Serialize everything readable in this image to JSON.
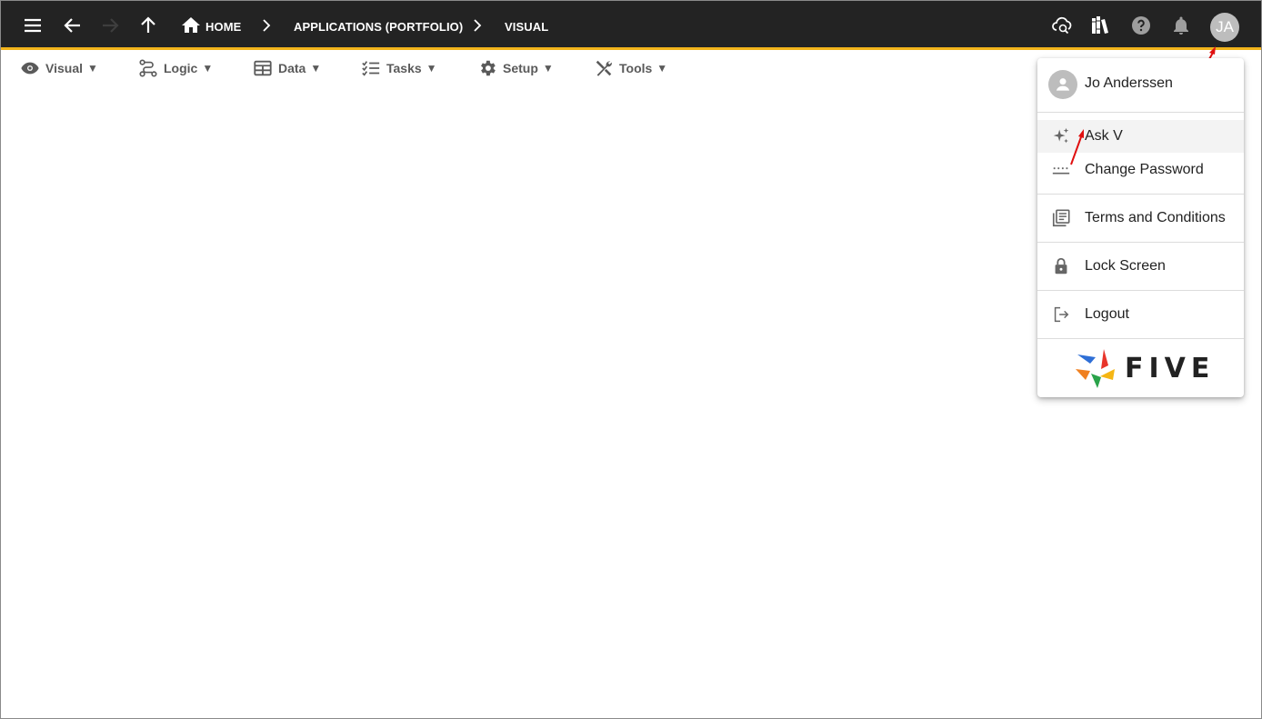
{
  "topbar": {
    "breadcrumbs": [
      "HOME",
      "APPLICATIONS (PORTFOLIO)",
      "VISUAL"
    ],
    "icons": [
      "menu-icon",
      "back-arrow-icon",
      "forward-arrow-icon",
      "up-arrow-icon",
      "home-icon",
      "cloud-sync-icon",
      "library-icon",
      "help-icon",
      "bell-icon"
    ],
    "avatar_initials": "JA"
  },
  "menubar": {
    "items": [
      {
        "label": "Visual",
        "icon": "eye-icon"
      },
      {
        "label": "Logic",
        "icon": "flow-icon"
      },
      {
        "label": "Data",
        "icon": "table-icon"
      },
      {
        "label": "Tasks",
        "icon": "checklist-icon"
      },
      {
        "label": "Setup",
        "icon": "gear-icon"
      },
      {
        "label": "Tools",
        "icon": "tools-icon"
      }
    ],
    "caret": "▼"
  },
  "user_menu": {
    "user_name": "Jo Anderssen",
    "items": [
      {
        "label": "Ask V",
        "icon": "sparkle-icon"
      },
      {
        "label": "Change Password",
        "icon": "password-icon"
      },
      {
        "label": "Terms and Conditions",
        "icon": "document-icon"
      },
      {
        "label": "Lock Screen",
        "icon": "lock-icon"
      },
      {
        "label": "Logout",
        "icon": "logout-icon"
      }
    ],
    "logo_text": "FIVE"
  },
  "colors": {
    "topbar_bg": "#232323",
    "accent": "#f2b41b",
    "annotation_arrow": "#e01010"
  }
}
